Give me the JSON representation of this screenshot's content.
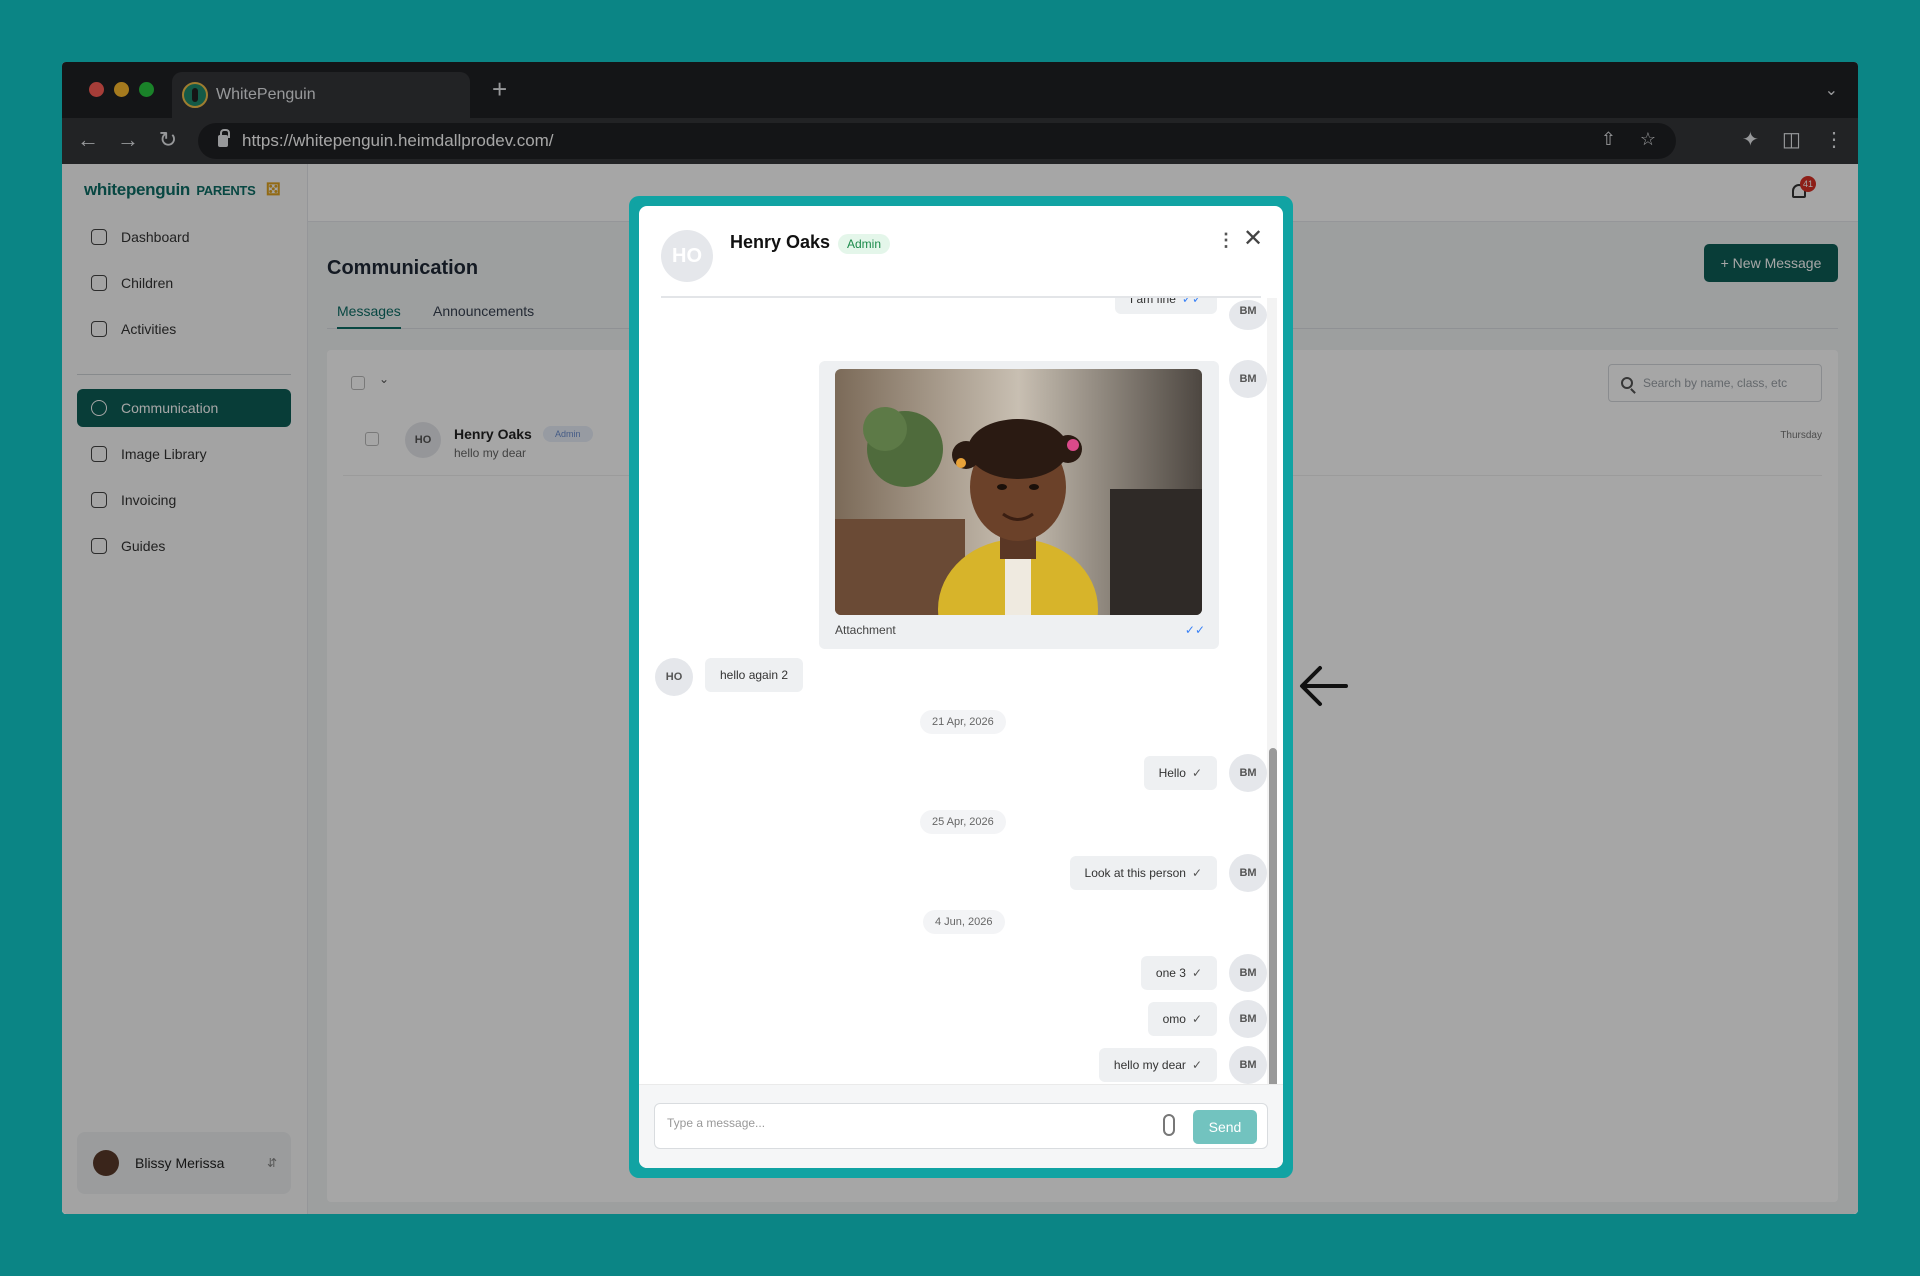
{
  "browser": {
    "tab_title": "WhitePenguin",
    "new_tab": "+",
    "url": "https://whitepenguin.heimdallprodev.com/"
  },
  "sidebar": {
    "logo": "whitepenguin",
    "logo_suffix": "PARENTS",
    "items": [
      {
        "label": "Dashboard",
        "icon": "dashboard-icon"
      },
      {
        "label": "Children",
        "icon": "children-icon"
      },
      {
        "label": "Activities",
        "icon": "activities-icon"
      },
      {
        "label": "Communication",
        "icon": "chat-icon",
        "active": true
      },
      {
        "label": "Image Library",
        "icon": "camera-icon"
      },
      {
        "label": "Invoicing",
        "icon": "invoice-icon"
      },
      {
        "label": "Guides",
        "icon": "guide-icon"
      }
    ],
    "user": {
      "name": "Blissy Merissa"
    }
  },
  "topbar": {
    "notification_count": "41"
  },
  "page": {
    "title": "Communication",
    "new_message_button": "+ New Message",
    "tabs": [
      "Messages",
      "Announcements"
    ],
    "search_placeholder": "Search by name, class, etc",
    "list": [
      {
        "initials": "HO",
        "name": "Henry Oaks",
        "badge": "Admin",
        "preview": "hello my dear",
        "date": "Thursday"
      }
    ]
  },
  "modal": {
    "contact_initials": "HO",
    "contact_name": "Henry Oaks",
    "contact_role": "Admin",
    "more_icon": "more-vertical-icon",
    "close_icon": "close-icon",
    "messages": [
      {
        "type": "out",
        "text": "I am fine",
        "initials": "BM"
      },
      {
        "type": "attachment",
        "label": "Attachment",
        "initials": "BM"
      },
      {
        "type": "in",
        "text": "hello again 2",
        "initials": "HO"
      },
      {
        "type": "date",
        "text": "21 Apr, 2026"
      },
      {
        "type": "out",
        "text": "Hello",
        "initials": "BM"
      },
      {
        "type": "date",
        "text": "25 Apr, 2026"
      },
      {
        "type": "out",
        "text": "Look at this person",
        "initials": "BM"
      },
      {
        "type": "date",
        "text": "4 Jun, 2026"
      },
      {
        "type": "out",
        "text": "one 3",
        "initials": "BM"
      },
      {
        "type": "out",
        "text": "omo",
        "initials": "BM"
      },
      {
        "type": "out",
        "text": "hello my dear",
        "initials": "BM"
      }
    ],
    "composer_placeholder": "Type a message...",
    "send_label": "Send"
  },
  "colors": {
    "background": "#0b8585",
    "brand": "#0d5f57",
    "modal_border": "#11a3a3",
    "send": "#72c3bf"
  }
}
